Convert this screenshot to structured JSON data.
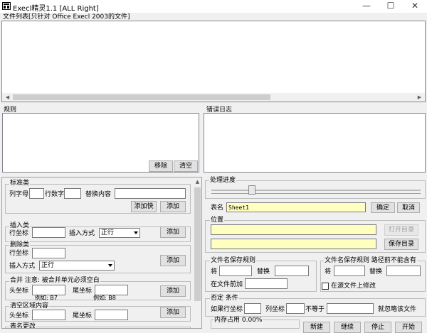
{
  "window": {
    "title": "Execl精灵1.1   [ALL Right]",
    "minimize": "—",
    "maximize": "☐",
    "close": "✕"
  },
  "file_list": {
    "label": "文件列表[只针对 Office Execl 2003的文件]"
  },
  "rules": {
    "label": "规则",
    "remove": "移除",
    "clear": "清空"
  },
  "error_log": {
    "label": "错误日志"
  },
  "standard": {
    "label": "标准类",
    "column_letter": "列字母",
    "row_number": "行数字",
    "replace_content": "替换内容",
    "add_fast": "添加快",
    "add": "添加"
  },
  "insert": {
    "label": "插入类",
    "row_coord": "行坐标",
    "insert_mode": "插入方式",
    "mode_value": "正行",
    "add": "添加"
  },
  "delete": {
    "label": "删除类",
    "row_coord": "行坐标",
    "insert_mode": "插入方式",
    "mode_value": "正行",
    "add": "添加"
  },
  "merge": {
    "label": "合并  注意: 被合并单元必须空白",
    "head_coord": "头坐标",
    "tail_coord": "尾坐标",
    "example_head": "例如: B7",
    "example_tail": "例如: B8",
    "add": "添加"
  },
  "clear_area": {
    "label": "清空区域内容",
    "head_coord": "头坐标",
    "tail_coord": "尾坐标",
    "add": "添加"
  },
  "cut_off": {
    "label": "表名更改"
  },
  "progress": {
    "label": "处理进度"
  },
  "sheet": {
    "label": "表名",
    "value": "Sheet1",
    "ok": "确定",
    "cancel": "取消"
  },
  "location": {
    "label": "位置",
    "open_dir": "打开目录",
    "save_dir": "保存目录"
  },
  "save_rule": {
    "label": "文件名保存规则",
    "will": "将",
    "replace": "替换",
    "prefix": "在文件前加"
  },
  "save_rule2": {
    "label": "文件名保存规则  路径前不能含有",
    "will": "将",
    "replace": "替换",
    "modify_source": "在源文件上修改"
  },
  "deny": {
    "label": "否定 条件",
    "if_row": "如果行坐标",
    "col_coord": "列坐标",
    "not_equal": "不等于",
    "skip": "就忽略该文件"
  },
  "memory": {
    "label": "内存占用 0.00%"
  },
  "actions": {
    "new": "新建",
    "continue": "继续",
    "stop": "停止",
    "start": "开始"
  }
}
